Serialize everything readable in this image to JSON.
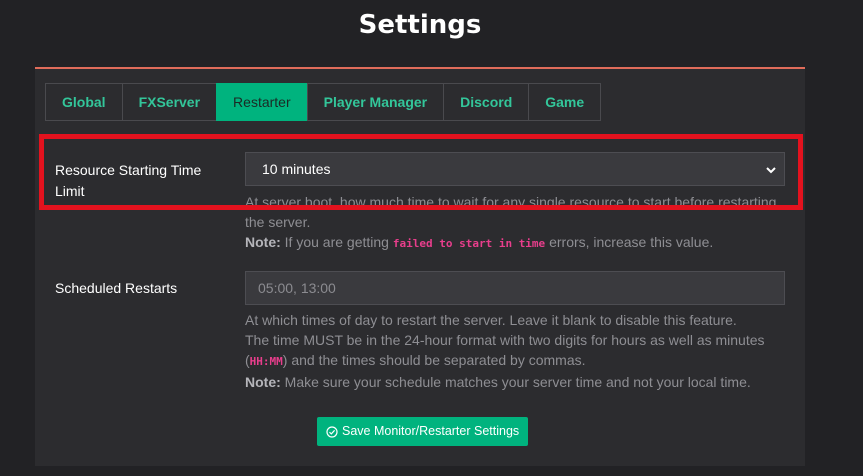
{
  "page": {
    "title": "Settings"
  },
  "tabs": [
    {
      "label": "Global",
      "active": false
    },
    {
      "label": "FXServer",
      "active": false
    },
    {
      "label": "Restarter",
      "active": true
    },
    {
      "label": "Player Manager",
      "active": false
    },
    {
      "label": "Discord",
      "active": false
    },
    {
      "label": "Game",
      "active": false
    }
  ],
  "resource_time_limit": {
    "label": "Resource Starting Time Limit",
    "selected_value": "10 minutes",
    "help_text": "At server boot, how much time to wait for any single resource to start before restarting the server.",
    "note_label": "Note:",
    "note_before": " If you are getting ",
    "note_code": "failed to start in time",
    "note_after": " errors, increase this value."
  },
  "scheduled_restarts": {
    "label": "Scheduled Restarts",
    "placeholder": "05:00, 13:00",
    "help_line1": "At which times of day to restart the server. Leave it blank to disable this feature.",
    "help_line2_before": "The time MUST be in the 24-hour format with two digits for hours as well as minutes (",
    "help_code": "HH:MM",
    "help_line2_after": ") and the times should be separated by commas.",
    "note_label": "Note:",
    "note_text": " Make sure your schedule matches your server time and not your local time."
  },
  "save_button": {
    "label": "Save Monitor/Restarter Settings",
    "icon": "check-circle-icon"
  },
  "colors": {
    "accent": "#00b37e",
    "tab_text": "#33c69a",
    "highlight": "#e3121e",
    "code": "#e83e8c",
    "card_border_top": "#e06c5a"
  }
}
